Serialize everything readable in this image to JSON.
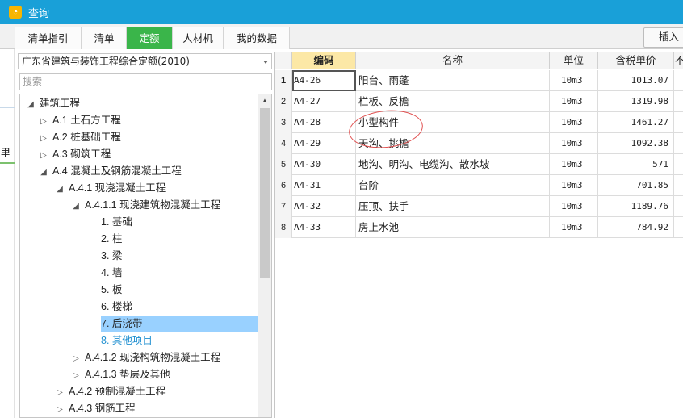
{
  "window": {
    "title": "查询",
    "icon": "app-logo-icon"
  },
  "tabs": [
    {
      "label": "清单指引",
      "active": false
    },
    {
      "label": "清单",
      "active": false
    },
    {
      "label": "定额",
      "active": true
    },
    {
      "label": "人材机",
      "active": false
    },
    {
      "label": "我的数据",
      "active": false
    }
  ],
  "insert_button": "插入",
  "background_edge_text": "里",
  "left": {
    "quota_book": "广东省建筑与装饰工程综合定额(2010)",
    "search_placeholder": "搜索",
    "tree": [
      {
        "label": "建筑工程",
        "level": 0,
        "state": "expanded"
      },
      {
        "label": "A.1 土石方工程",
        "level": 1,
        "state": "collapsed"
      },
      {
        "label": "A.2 桩基础工程",
        "level": 1,
        "state": "collapsed"
      },
      {
        "label": "A.3 砌筑工程",
        "level": 1,
        "state": "collapsed"
      },
      {
        "label": "A.4 混凝土及钢筋混凝土工程",
        "level": 1,
        "state": "expanded"
      },
      {
        "label": "A.4.1 现浇混凝土工程",
        "level": 2,
        "state": "expanded"
      },
      {
        "label": "A.4.1.1 现浇建筑物混凝土工程",
        "level": 3,
        "state": "expanded"
      },
      {
        "label": "1. 基础",
        "level": 4,
        "state": "leaf"
      },
      {
        "label": "2. 柱",
        "level": 4,
        "state": "leaf"
      },
      {
        "label": "3. 梁",
        "level": 4,
        "state": "leaf"
      },
      {
        "label": "4. 墙",
        "level": 4,
        "state": "leaf"
      },
      {
        "label": "5. 板",
        "level": 4,
        "state": "leaf"
      },
      {
        "label": "6. 楼梯",
        "level": 4,
        "state": "leaf"
      },
      {
        "label": "7. 后浇带",
        "level": 4,
        "state": "leaf",
        "selected": true
      },
      {
        "label": "8. 其他项目",
        "level": 4,
        "state": "leaf",
        "link": true
      },
      {
        "label": "A.4.1.2 现浇构筑物混凝土工程",
        "level": 3,
        "state": "collapsed"
      },
      {
        "label": "A.4.1.3 垫层及其他",
        "level": 3,
        "state": "collapsed"
      },
      {
        "label": "A.4.2 预制混凝土工程",
        "level": 2,
        "state": "collapsed"
      },
      {
        "label": "A.4.3 钢筋工程",
        "level": 2,
        "state": "collapsed"
      }
    ]
  },
  "grid": {
    "columns": [
      "编码",
      "名称",
      "单位",
      "含税单价",
      "不"
    ],
    "rows": [
      {
        "no": "1",
        "code": "A4-26",
        "name": "阳台、雨蓬",
        "unit": "10m3",
        "price": "1013.07"
      },
      {
        "no": "2",
        "code": "A4-27",
        "name": "栏板、反檐",
        "unit": "10m3",
        "price": "1319.98"
      },
      {
        "no": "3",
        "code": "A4-28",
        "name": "小型构件",
        "unit": "10m3",
        "price": "1461.27"
      },
      {
        "no": "4",
        "code": "A4-29",
        "name": "天沟、挑檐",
        "unit": "10m3",
        "price": "1092.38"
      },
      {
        "no": "5",
        "code": "A4-30",
        "name": "地沟、明沟、电缆沟、散水坡",
        "unit": "10m3",
        "price": "571"
      },
      {
        "no": "6",
        "code": "A4-31",
        "name": "台阶",
        "unit": "10m3",
        "price": "701.85"
      },
      {
        "no": "7",
        "code": "A4-32",
        "name": "压顶、扶手",
        "unit": "10m3",
        "price": "1189.76"
      },
      {
        "no": "8",
        "code": "A4-33",
        "name": "房上水池",
        "unit": "10m3",
        "price": "784.92"
      }
    ]
  },
  "colors": {
    "titlebar": "#19a0d8",
    "active_tab": "#3ab54a",
    "selected_row": "#99d1ff",
    "annotation": "#e05050"
  }
}
